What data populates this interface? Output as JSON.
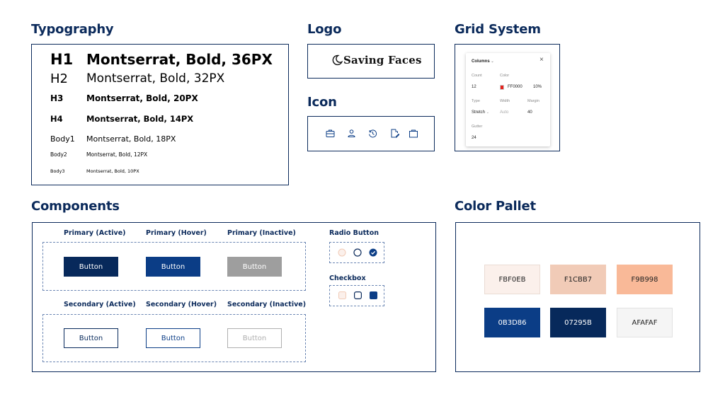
{
  "sections": {
    "typography": "Typography",
    "logo": "Logo",
    "icon": "Icon",
    "grid": "Grid System",
    "components": "Components",
    "palette": "Color Pallet"
  },
  "typography": [
    {
      "label": "H1",
      "value": "Montserrat, Bold, 36PX"
    },
    {
      "label": "H2",
      "value": "Montserrat, Bold, 32PX"
    },
    {
      "label": "H3",
      "value": "Montserrat, Bold, 20PX"
    },
    {
      "label": "H4",
      "value": "Montserrat, Bold, 14PX"
    },
    {
      "label": "Body1",
      "value": "Montserrat, Bold, 18PX"
    },
    {
      "label": "Body2",
      "value": "Montserrat, Bold, 12PX"
    },
    {
      "label": "Body3",
      "value": "Montserrat, Bold, 10PX"
    }
  ],
  "logo": {
    "text": "Saving Faces",
    "icon": "crescent-moon-icon"
  },
  "icons": [
    "briefcase-icon",
    "user-icon",
    "history-icon",
    "document-edit-icon",
    "shopping-bag-icon"
  ],
  "grid_panel": {
    "title": "Columns",
    "count_label": "Count",
    "count_value": "12",
    "color_label": "Color",
    "color_value": "FF0000",
    "color_swatch": "#E5231E",
    "opacity": "10%",
    "type_label": "Type",
    "type_value": "Stretch",
    "width_label": "Width",
    "width_value": "Auto",
    "margin_label": "Margin",
    "margin_value": "40",
    "gutter_label": "Gutter",
    "gutter_value": "24"
  },
  "components": {
    "primary_active": "Primary (Active)",
    "primary_hover": "Primary (Hover)",
    "primary_inactive": "Primary (Inactive)",
    "secondary_active": "Secondary (Active)",
    "secondary_hover": "Secondary (Hover)",
    "secondary_inactive": "Secondary (Inactive)",
    "button_label": "Button",
    "radio_label": "Radio Button",
    "checkbox_label": "Checkbox",
    "colors": {
      "primary_active": "#07295B",
      "primary_hover": "#0B3D86",
      "primary_inactive": "#9E9E9E",
      "secondary_inactive_border": "#AFAFAF"
    }
  },
  "palette": [
    {
      "hex": "FBF0EB",
      "color": "#FBF0EB",
      "text_color": "#222222"
    },
    {
      "hex": "F1CBB7",
      "color": "#F1CBB7",
      "text_color": "#222222"
    },
    {
      "hex": "F9B998",
      "color": "#F9B998",
      "text_color": "#222222"
    },
    {
      "hex": "0B3D86",
      "color": "#0B3D86",
      "text_color": "#ffffff"
    },
    {
      "hex": "07295B",
      "color": "#07295B",
      "text_color": "#ffffff"
    },
    {
      "hex": "AFAFAF",
      "color": "#F5F5F5",
      "text_color": "#222222"
    }
  ]
}
